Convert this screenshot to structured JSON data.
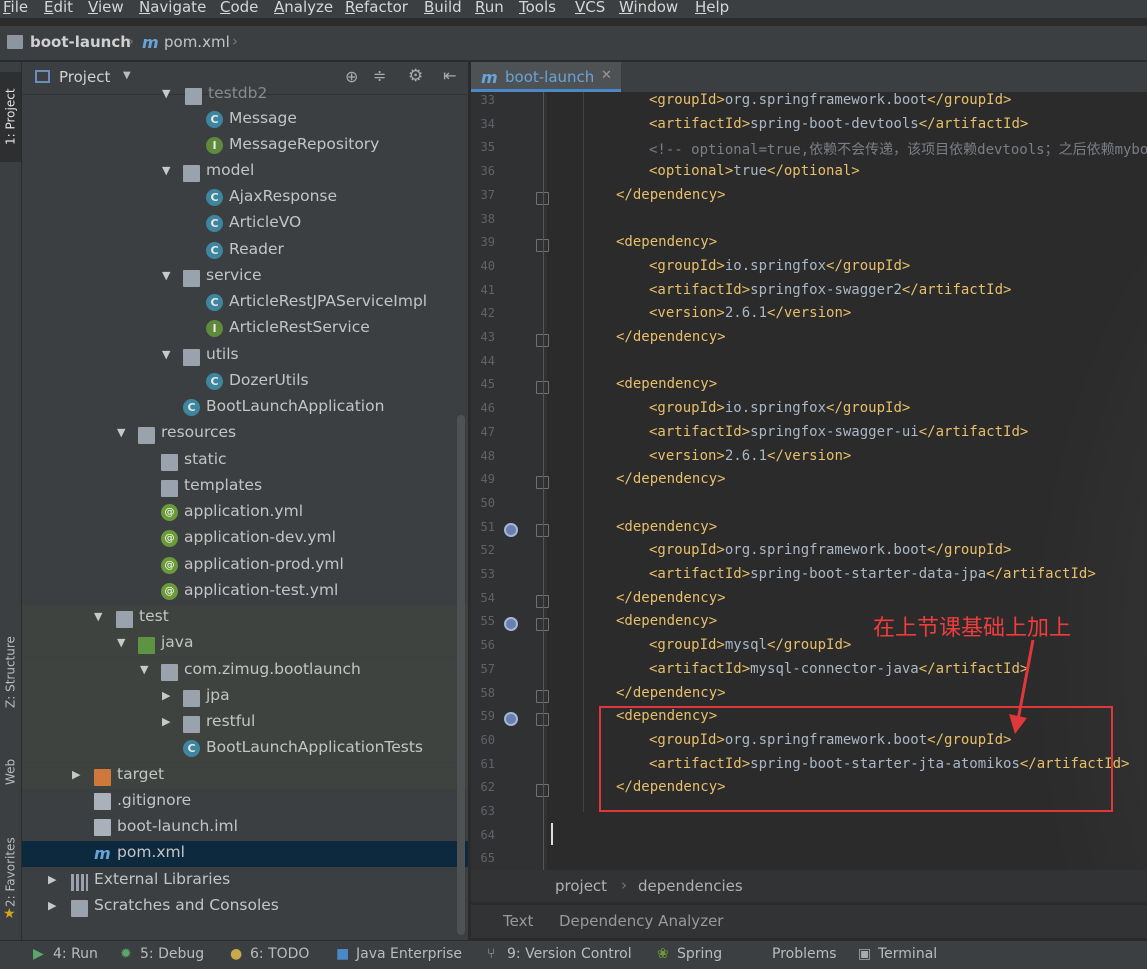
{
  "menu": [
    "File",
    "Edit",
    "View",
    "Navigate",
    "Code",
    "Analyze",
    "Refactor",
    "Build",
    "Run",
    "Tools",
    "VCS",
    "Window",
    "Help"
  ],
  "navbar": {
    "project": "boot-launch",
    "file": "pom.xml"
  },
  "leftstrip": {
    "project_tab": "1: Project",
    "structure_tab": "Z: Structure",
    "web_tab": "Web",
    "favorites_tab": "2: Favorites"
  },
  "project_panel": {
    "title": "Project",
    "tree": [
      {
        "label": "testdb2",
        "icon": "folder-icon",
        "expanded": true
      },
      {
        "label": "Message",
        "icon": "class-icon"
      },
      {
        "label": "MessageRepository",
        "icon": "interface-icon"
      },
      {
        "label": "model",
        "icon": "folder-icon",
        "expanded": true
      },
      {
        "label": "AjaxResponse",
        "icon": "class-icon"
      },
      {
        "label": "ArticleVO",
        "icon": "class-icon"
      },
      {
        "label": "Reader",
        "icon": "class-icon"
      },
      {
        "label": "service",
        "icon": "folder-icon",
        "expanded": true
      },
      {
        "label": "ArticleRestJPAServiceImpl",
        "icon": "class-icon"
      },
      {
        "label": "ArticleRestService",
        "icon": "interface-icon"
      },
      {
        "label": "utils",
        "icon": "folder-icon",
        "expanded": true
      },
      {
        "label": "DozerUtils",
        "icon": "class-icon"
      },
      {
        "label": "BootLaunchApplication",
        "icon": "spring-boot-class-icon"
      },
      {
        "label": "resources",
        "icon": "resources-folder-icon",
        "expanded": true
      },
      {
        "label": "static",
        "icon": "folder-icon"
      },
      {
        "label": "templates",
        "icon": "folder-icon"
      },
      {
        "label": "application.yml",
        "icon": "spring-yml-icon"
      },
      {
        "label": "application-dev.yml",
        "icon": "spring-yml-icon"
      },
      {
        "label": "application-prod.yml",
        "icon": "spring-yml-icon"
      },
      {
        "label": "application-test.yml",
        "icon": "spring-yml-icon"
      },
      {
        "label": "test",
        "icon": "folder-icon",
        "expanded": true
      },
      {
        "label": "java",
        "icon": "test-folder-icon",
        "expanded": true
      },
      {
        "label": "com.zimug.bootlaunch",
        "icon": "package-icon",
        "expanded": true
      },
      {
        "label": "jpa",
        "icon": "package-icon",
        "expanded": false
      },
      {
        "label": "restful",
        "icon": "package-icon",
        "expanded": false
      },
      {
        "label": "BootLaunchApplicationTests",
        "icon": "test-class-icon"
      },
      {
        "label": "target",
        "icon": "excluded-folder-icon",
        "expanded": false
      },
      {
        "label": ".gitignore",
        "icon": "file-icon"
      },
      {
        "label": "boot-launch.iml",
        "icon": "iml-file-icon"
      },
      {
        "label": "pom.xml",
        "icon": "maven-icon",
        "selected": true
      },
      {
        "label": "External Libraries",
        "icon": "library-icon",
        "expanded": false
      },
      {
        "label": "Scratches and Consoles",
        "icon": "scratches-icon",
        "expanded": false
      }
    ]
  },
  "editor": {
    "tab": "boot-launch",
    "lines": [
      {
        "n": "33",
        "indent": 2,
        "parts": [
          [
            "tag",
            "<groupId>"
          ],
          [
            "txt",
            "org.springframework.boot"
          ],
          [
            "tag",
            "</groupId>"
          ]
        ]
      },
      {
        "n": "34",
        "indent": 2,
        "parts": [
          [
            "tag",
            "<artifactId>"
          ],
          [
            "txt",
            "spring-boot-devtools"
          ],
          [
            "tag",
            "</artifactId>"
          ]
        ]
      },
      {
        "n": "35",
        "indent": 2,
        "parts": [
          [
            "com",
            "<!-- optional=true,依赖不会传递，该项目依赖devtools；之后依赖mybo"
          ]
        ]
      },
      {
        "n": "36",
        "indent": 2,
        "parts": [
          [
            "tag",
            "<optional>"
          ],
          [
            "txt",
            "true"
          ],
          [
            "tag",
            "</optional>"
          ]
        ]
      },
      {
        "n": "37",
        "indent": 1,
        "parts": [
          [
            "tag",
            "</dependency>"
          ]
        ]
      },
      {
        "n": "38",
        "indent": 0,
        "parts": []
      },
      {
        "n": "39",
        "indent": 1,
        "parts": [
          [
            "tag",
            "<dependency>"
          ]
        ]
      },
      {
        "n": "40",
        "indent": 2,
        "parts": [
          [
            "tag",
            "<groupId>"
          ],
          [
            "txt",
            "io.springfox"
          ],
          [
            "tag",
            "</groupId>"
          ]
        ]
      },
      {
        "n": "41",
        "indent": 2,
        "parts": [
          [
            "tag",
            "<artifactId>"
          ],
          [
            "txt",
            "springfox-swagger2"
          ],
          [
            "tag",
            "</artifactId>"
          ]
        ]
      },
      {
        "n": "42",
        "indent": 2,
        "parts": [
          [
            "tag",
            "<version>"
          ],
          [
            "txt",
            "2.6.1"
          ],
          [
            "tag",
            "</version>"
          ]
        ]
      },
      {
        "n": "43",
        "indent": 1,
        "parts": [
          [
            "tag",
            "</dependency>"
          ]
        ]
      },
      {
        "n": "44",
        "indent": 0,
        "parts": []
      },
      {
        "n": "45",
        "indent": 1,
        "parts": [
          [
            "tag",
            "<dependency>"
          ]
        ]
      },
      {
        "n": "46",
        "indent": 2,
        "parts": [
          [
            "tag",
            "<groupId>"
          ],
          [
            "txt",
            "io.springfox"
          ],
          [
            "tag",
            "</groupId>"
          ]
        ]
      },
      {
        "n": "47",
        "indent": 2,
        "parts": [
          [
            "tag",
            "<artifactId>"
          ],
          [
            "txt",
            "springfox-swagger-ui"
          ],
          [
            "tag",
            "</artifactId>"
          ]
        ]
      },
      {
        "n": "48",
        "indent": 2,
        "parts": [
          [
            "tag",
            "<version>"
          ],
          [
            "txt",
            "2.6.1"
          ],
          [
            "tag",
            "</version>"
          ]
        ]
      },
      {
        "n": "49",
        "indent": 1,
        "parts": [
          [
            "tag",
            "</dependency>"
          ]
        ]
      },
      {
        "n": "50",
        "indent": 0,
        "parts": []
      },
      {
        "n": "51",
        "indent": 1,
        "parts": [
          [
            "tag",
            "<dependency>"
          ]
        ]
      },
      {
        "n": "52",
        "indent": 2,
        "parts": [
          [
            "tag",
            "<groupId>"
          ],
          [
            "txt",
            "org.springframework.boot"
          ],
          [
            "tag",
            "</groupId>"
          ]
        ]
      },
      {
        "n": "53",
        "indent": 2,
        "parts": [
          [
            "tag",
            "<artifactId>"
          ],
          [
            "txt",
            "spring-boot-starter-data-jpa"
          ],
          [
            "tag",
            "</artifactId>"
          ]
        ]
      },
      {
        "n": "54",
        "indent": 1,
        "parts": [
          [
            "tag",
            "</dependency>"
          ]
        ]
      },
      {
        "n": "55",
        "indent": 1,
        "parts": [
          [
            "tag",
            "<dependency>"
          ]
        ]
      },
      {
        "n": "56",
        "indent": 2,
        "parts": [
          [
            "tag",
            "<groupId>"
          ],
          [
            "txt",
            "mysql"
          ],
          [
            "tag",
            "</groupId>"
          ]
        ]
      },
      {
        "n": "57",
        "indent": 2,
        "parts": [
          [
            "tag",
            "<artifactId>"
          ],
          [
            "txt",
            "mysql-connector-java"
          ],
          [
            "tag",
            "</artifactId>"
          ]
        ]
      },
      {
        "n": "58",
        "indent": 1,
        "parts": [
          [
            "tag",
            "</dependency>"
          ]
        ]
      },
      {
        "n": "59",
        "indent": 1,
        "parts": [
          [
            "tag",
            "<dependency>"
          ]
        ]
      },
      {
        "n": "60",
        "indent": 2,
        "parts": [
          [
            "tag",
            "<groupId>"
          ],
          [
            "txt",
            "org.springframework.boot"
          ],
          [
            "tag",
            "</groupId>"
          ]
        ]
      },
      {
        "n": "61",
        "indent": 2,
        "parts": [
          [
            "tag",
            "<artifactId>"
          ],
          [
            "txt",
            "spring-boot-starter-jta-atomikos"
          ],
          [
            "tag",
            "</artifactId>"
          ]
        ]
      },
      {
        "n": "62",
        "indent": 1,
        "parts": [
          [
            "tag",
            "</dependency>"
          ]
        ]
      },
      {
        "n": "63",
        "indent": 0,
        "parts": []
      },
      {
        "n": "64",
        "indent": 0,
        "parts": []
      },
      {
        "n": "65",
        "indent": 0,
        "parts": []
      }
    ],
    "annotation": "在上节课基础上加上",
    "breadcrumb": [
      "project",
      "dependencies"
    ],
    "bottom_tabs": [
      "Text",
      "Dependency Analyzer"
    ]
  },
  "statusbar": [
    "4: Run",
    "5: Debug",
    "6: TODO",
    "Java Enterprise",
    "9: Version Control",
    "Spring",
    "Problems",
    "Terminal"
  ],
  "colors": {
    "annotation": "#e0373a",
    "tag": "#e8bf6a",
    "selection": "#0d293e"
  }
}
